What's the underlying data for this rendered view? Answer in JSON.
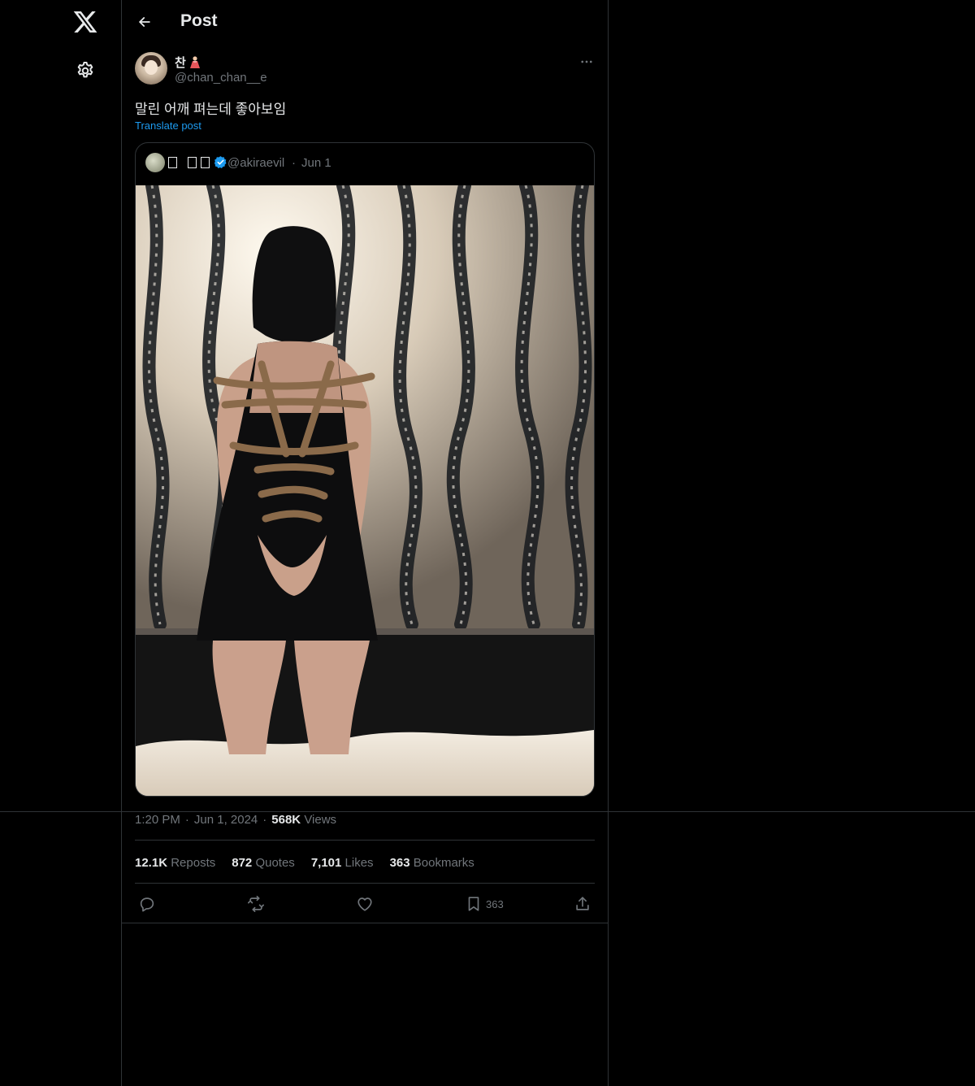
{
  "header": {
    "title": "Post"
  },
  "author": {
    "display_name": "찬",
    "handle": "@chan_chan__e"
  },
  "post": {
    "text": "말린 어깨 펴는데 좋아보임",
    "translate_label": "Translate post"
  },
  "quoted": {
    "handle": "@akiraevil",
    "separator": "·",
    "date": "Jun 1"
  },
  "meta": {
    "time": "1:20 PM",
    "separator": "·",
    "date": "Jun 1, 2024",
    "separator2": "·",
    "views_count": "568K",
    "views_label": "Views"
  },
  "stats": [
    {
      "count": "12.1K",
      "label": "Reposts"
    },
    {
      "count": "872",
      "label": "Quotes"
    },
    {
      "count": "7,101",
      "label": "Likes"
    },
    {
      "count": "363",
      "label": "Bookmarks"
    }
  ],
  "actions": {
    "bookmark_count": "363"
  },
  "colors": {
    "background": "#000000",
    "border": "#2f3336",
    "text_primary": "#e7e9ea",
    "text_secondary": "#71767b",
    "accent": "#1d9bf0"
  },
  "icons": [
    "x-logo-icon",
    "gear-icon",
    "back-arrow-icon",
    "more-icon",
    "verified-icon",
    "reply-icon",
    "repost-icon",
    "like-icon",
    "bookmark-icon",
    "share-icon"
  ]
}
